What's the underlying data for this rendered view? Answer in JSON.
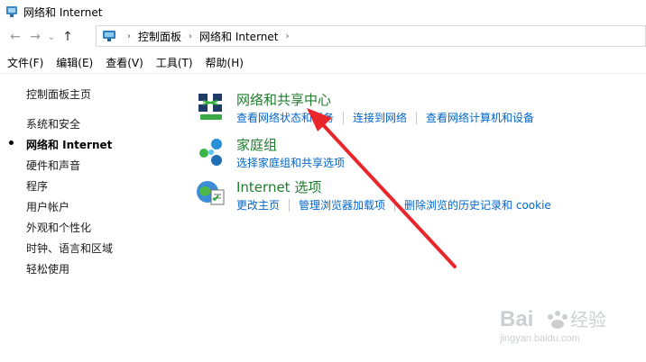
{
  "window": {
    "title": "网络和 Internet"
  },
  "address": {
    "crumbs": [
      "控制面板",
      "网络和 Internet"
    ]
  },
  "menubar": {
    "items": [
      "文件(F)",
      "编辑(E)",
      "查看(V)",
      "工具(T)",
      "帮助(H)"
    ]
  },
  "sidebar": {
    "home": "控制面板主页",
    "items": [
      "系统和安全",
      "网络和 Internet",
      "硬件和声音",
      "程序",
      "用户帐户",
      "外观和个性化",
      "时钟、语言和区域",
      "轻松使用"
    ],
    "current_index": 1
  },
  "categories": [
    {
      "title": "网络和共享中心",
      "icon": "network-sharing-center-icon",
      "links": [
        "查看网络状态和任务",
        "连接到网络",
        "查看网络计算机和设备"
      ]
    },
    {
      "title": "家庭组",
      "icon": "homegroup-icon",
      "links": [
        "选择家庭组和共享选项"
      ]
    },
    {
      "title": "Internet 选项",
      "icon": "internet-options-icon",
      "links": [
        "更改主页",
        "管理浏览器加载项",
        "删除浏览的历史记录和 cookie"
      ]
    }
  ],
  "annotation": {
    "color": "#e8262b"
  },
  "watermark": {
    "text": "Bai 经验",
    "url": "jingyan.baidu.com"
  },
  "colors": {
    "category_title": "#1e7d2d",
    "link": "#0066cc"
  }
}
